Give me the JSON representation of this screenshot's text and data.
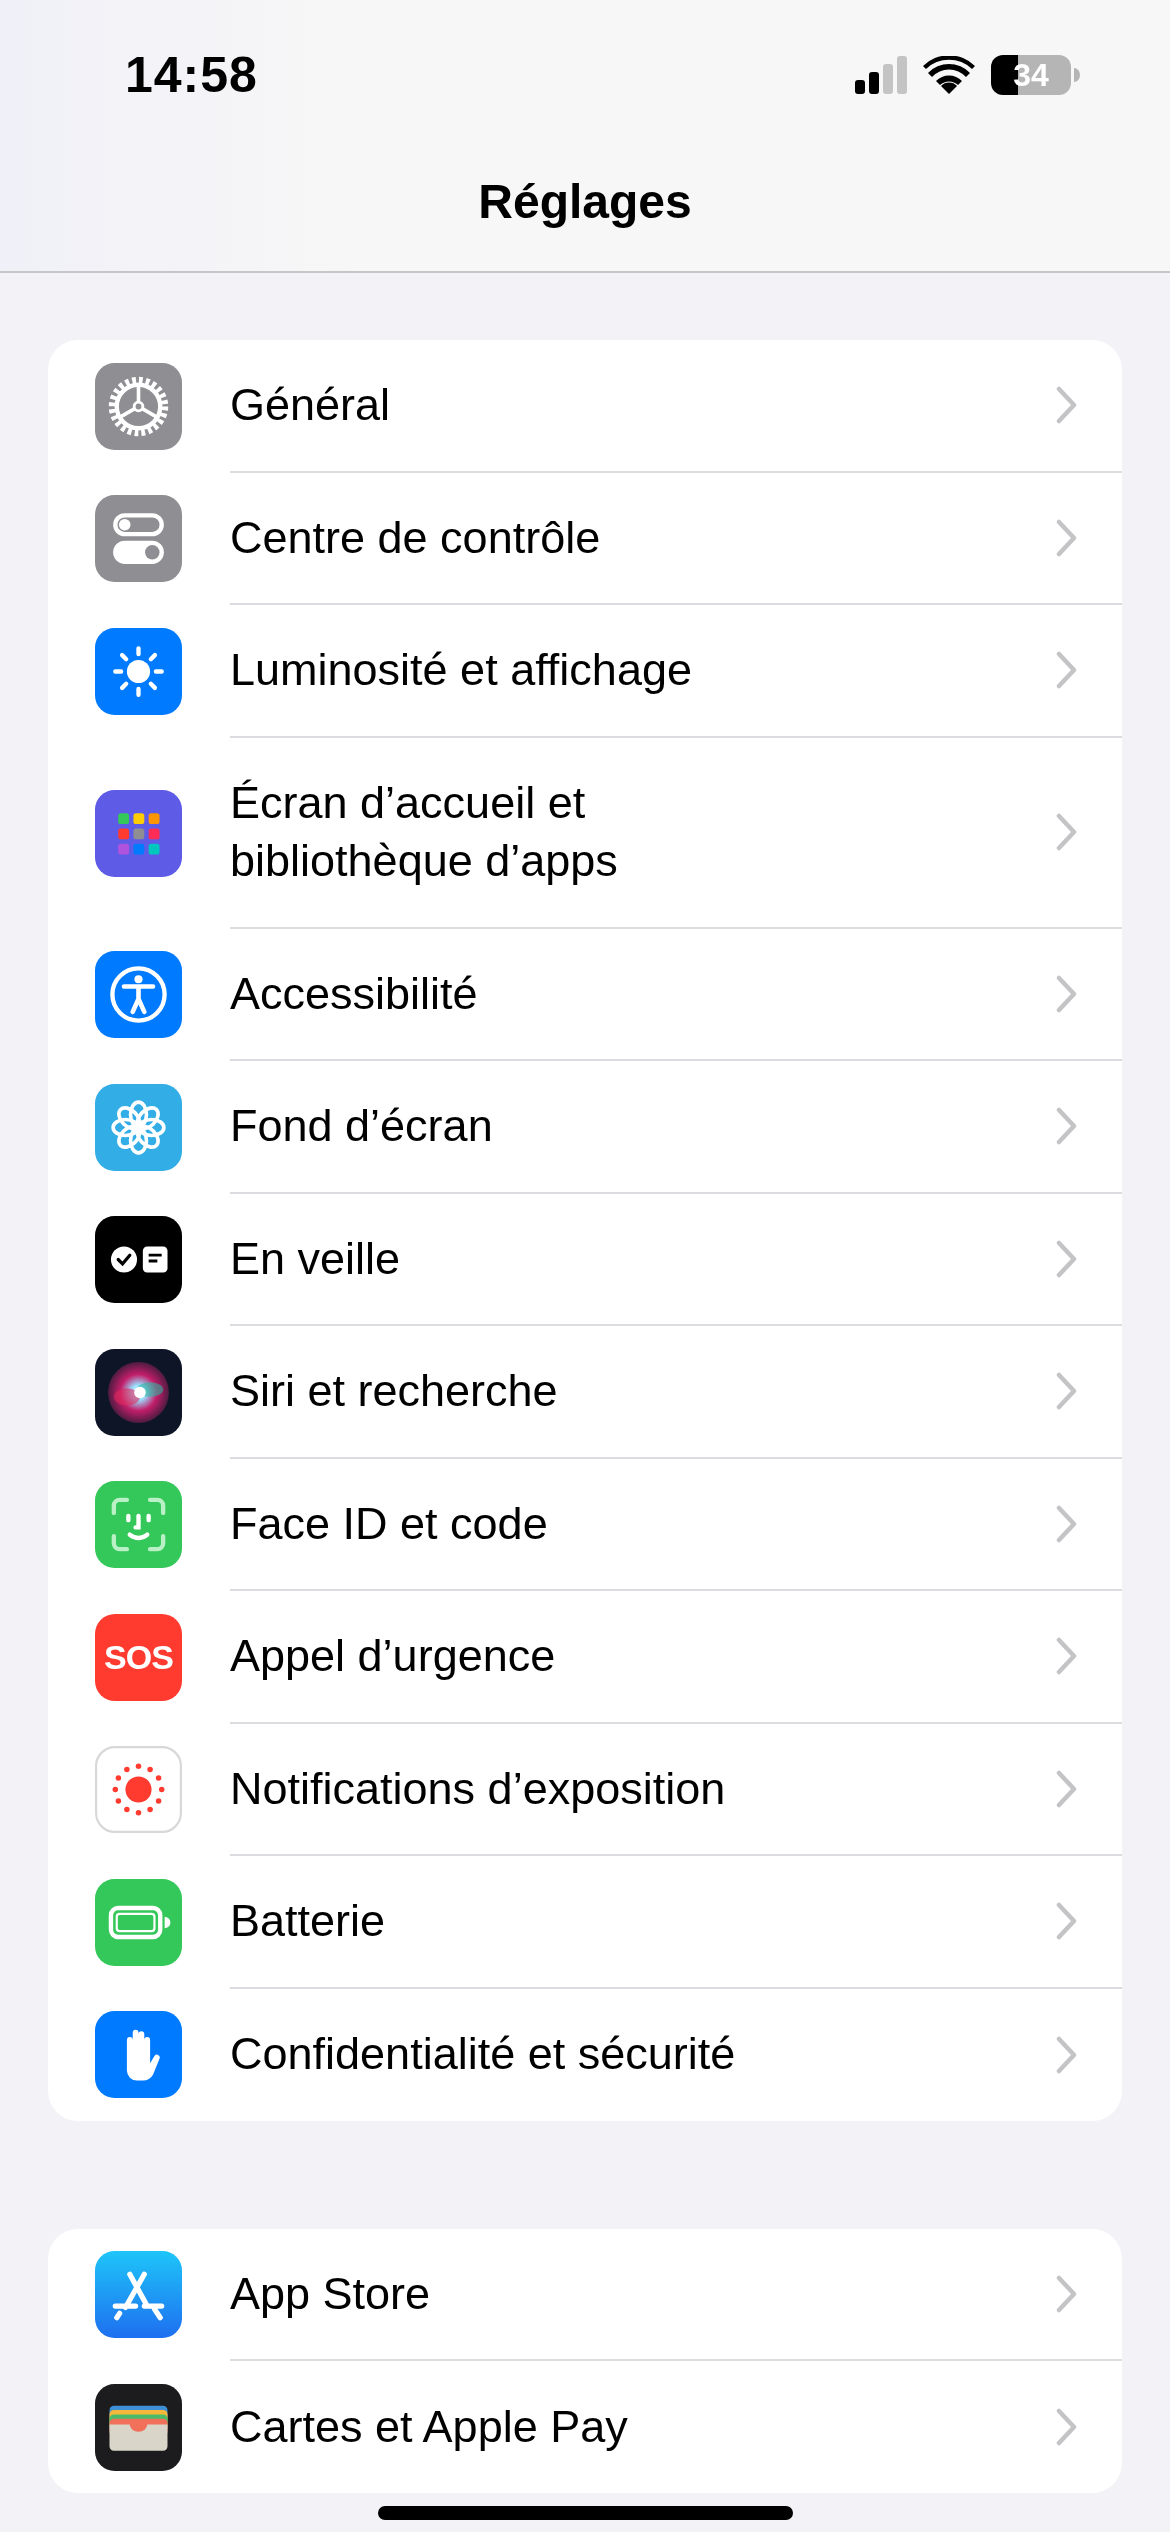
{
  "status_bar": {
    "time": "14:58",
    "battery": "34"
  },
  "nav": {
    "title": "Réglages"
  },
  "groups": [
    {
      "items": [
        {
          "label": "Général"
        },
        {
          "label": "Centre de contrôle"
        },
        {
          "label": "Luminosité et affichage"
        },
        {
          "label": "Écran d’accueil et bibliothèque d’apps"
        },
        {
          "label": "Accessibilité"
        },
        {
          "label": "Fond d’écran"
        },
        {
          "label": "En veille"
        },
        {
          "label": "Siri et recherche"
        },
        {
          "label": "Face ID et code"
        },
        {
          "label": "Appel d’urgence",
          "icon_text": "SOS"
        },
        {
          "label": "Notifications d’exposition"
        },
        {
          "label": "Batterie"
        },
        {
          "label": "Confidentialité et sécurité"
        }
      ]
    },
    {
      "items": [
        {
          "label": "App Store"
        },
        {
          "label": "Cartes et Apple Pay"
        }
      ]
    }
  ]
}
